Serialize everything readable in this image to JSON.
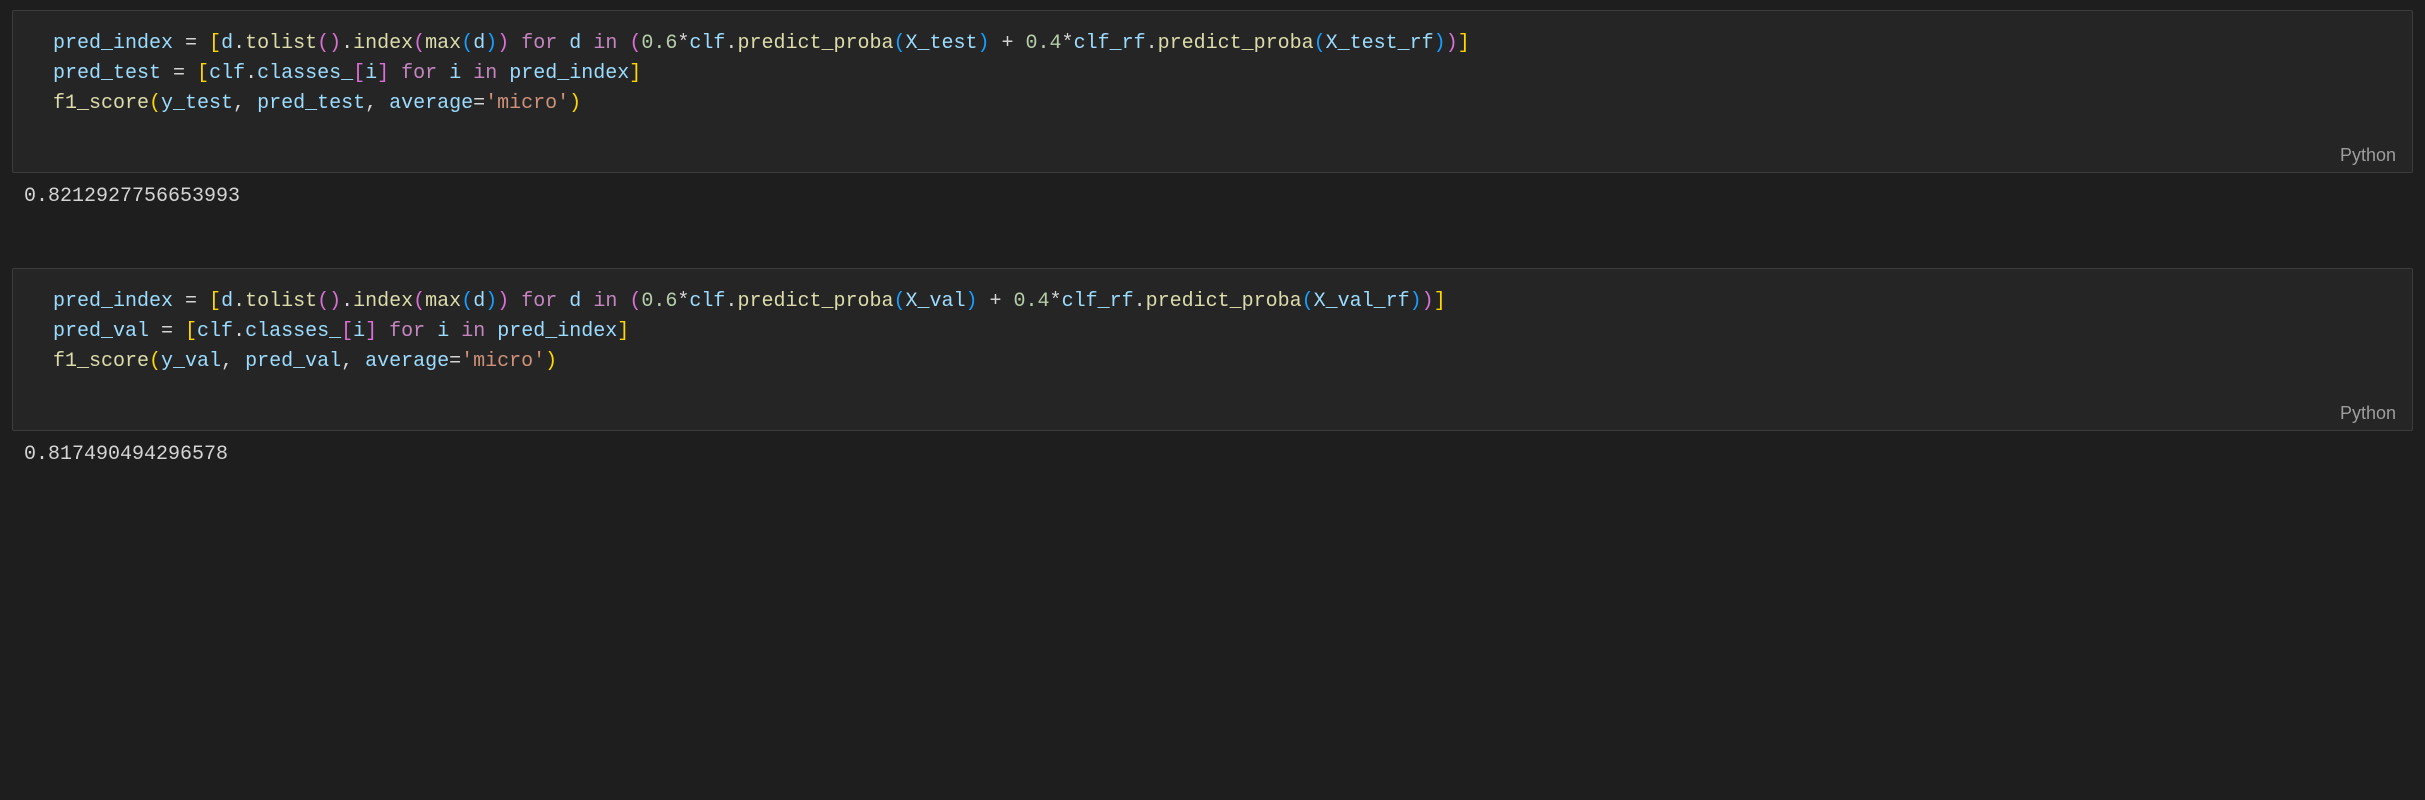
{
  "cells": [
    {
      "language": "Python",
      "output": "0.8212927756653993",
      "code": {
        "l1": {
          "v_pred_index": "pred_index",
          "v_d": "d",
          "f_tolist": "tolist",
          "f_index": "index",
          "f_max": "max",
          "kw_for": "for",
          "kw_in": "in",
          "n_06": "0.6",
          "v_clf": "clf",
          "f_predict_proba": "predict_proba",
          "v_X_test": "X_test",
          "n_04": "0.4",
          "v_clf_rf": "clf_rf",
          "v_X_test_rf": "X_test_rf"
        },
        "l2": {
          "v_pred_test": "pred_test",
          "v_clf": "clf",
          "v_classes_": "classes_",
          "v_i": "i",
          "kw_for": "for",
          "kw_in": "in",
          "v_pred_index": "pred_index"
        },
        "l3": {
          "f_f1_score": "f1_score",
          "v_y_test": "y_test",
          "v_pred_test": "pred_test",
          "v_average": "average",
          "s_micro": "'micro'"
        }
      }
    },
    {
      "language": "Python",
      "output": "0.817490494296578",
      "code": {
        "l1": {
          "v_pred_index": "pred_index",
          "v_d": "d",
          "f_tolist": "tolist",
          "f_index": "index",
          "f_max": "max",
          "kw_for": "for",
          "kw_in": "in",
          "n_06": "0.6",
          "v_clf": "clf",
          "f_predict_proba": "predict_proba",
          "v_X_val": "X_val",
          "n_04": "0.4",
          "v_clf_rf": "clf_rf",
          "v_X_val_rf": "X_val_rf"
        },
        "l2": {
          "v_pred_val": "pred_val",
          "v_clf": "clf",
          "v_classes_": "classes_",
          "v_i": "i",
          "kw_for": "for",
          "kw_in": "in",
          "v_pred_index": "pred_index"
        },
        "l3": {
          "f_f1_score": "f1_score",
          "v_y_val": "y_val",
          "v_pred_val": "pred_val",
          "v_average": "average",
          "s_micro": "'micro'"
        }
      }
    }
  ]
}
